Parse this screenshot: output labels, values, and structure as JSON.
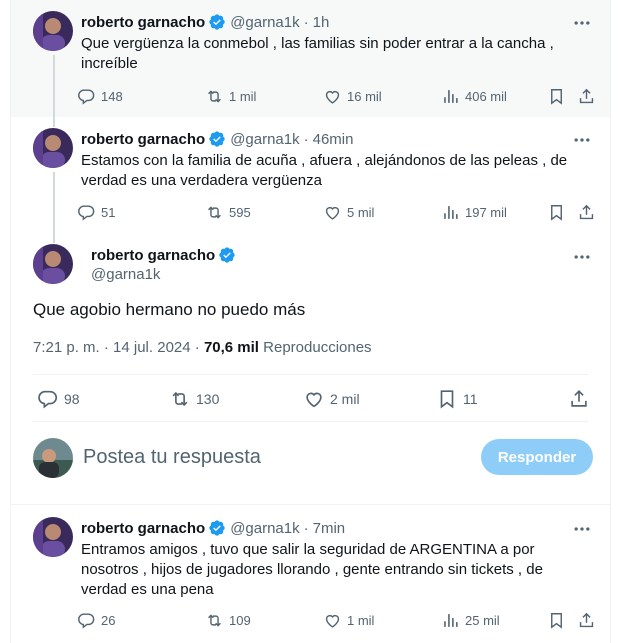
{
  "colors": {
    "accent": "#1d9bf0",
    "muted": "#536471",
    "reply_button_bg": "#8ecdf8",
    "text": "#0f1419"
  },
  "thread": [
    {
      "name": "roberto garnacho",
      "handle": "@garna1k",
      "time": "1h",
      "text_lines": [
        "Que vergüenza la conmebol , las familias sin poder entrar a la cancha ,",
        "increíble"
      ],
      "replies": "148",
      "reposts": "1 mil",
      "likes": "16 mil",
      "views": "406 mil"
    },
    {
      "name": "roberto garnacho",
      "handle": "@garna1k",
      "time": "46min",
      "text_lines": [
        "Estamos con la familia de acuña , afuera , alejándonos de las peleas , de",
        "verdad es una verdadera vergüenza"
      ],
      "replies": "51",
      "reposts": "595",
      "likes": "5 mil",
      "views": "197 mil"
    }
  ],
  "main": {
    "name": "roberto garnacho",
    "handle": "@garna1k",
    "text": "Que agobio hermano no puedo más",
    "time_date": "7:21 p. m. · 14 jul. 2024 ·",
    "views_count": "70,6 mil",
    "views_label": "Reproducciones",
    "replies": "98",
    "reposts": "130",
    "likes": "2 mil",
    "bookmarks": "11"
  },
  "reply_box": {
    "placeholder": "Postea tu respuesta",
    "button_label": "Responder"
  },
  "reply": {
    "name": "roberto garnacho",
    "handle": "@garna1k",
    "time": "7min",
    "text_lines": [
      "Entramos amigos , tuvo que salir la seguridad de ARGENTINA a por",
      "nosotros , hijos de jugadores llorando , gente entrando sin tickets , de",
      "verdad es una pena"
    ],
    "replies": "26",
    "reposts": "109",
    "likes": "1 mil",
    "views": "25 mil"
  },
  "icons": [
    "more-icon",
    "verified-icon",
    "reply-icon",
    "repost-icon",
    "like-icon",
    "views-icon",
    "bookmark-icon",
    "share-icon"
  ]
}
